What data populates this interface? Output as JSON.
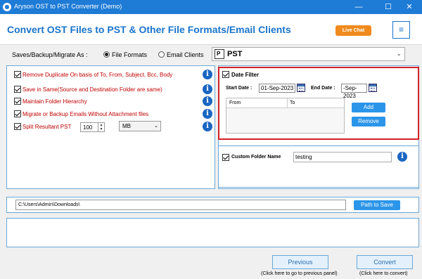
{
  "window": {
    "title": "Aryson OST to PST Converter (Demo)",
    "controls": {
      "minimize": "—",
      "maximize": "☐",
      "close": "✕"
    }
  },
  "header": {
    "heading": "Convert OST Files to PST & Other File Formats/Email Clients",
    "live_chat": "Live Chat",
    "menu_icon": "≡"
  },
  "saves": {
    "label": "Saves/Backup/Migrate As :",
    "options": [
      "File Formats",
      "Email Clients"
    ],
    "selected_option": "File Formats",
    "format_value": "PST",
    "format_icon": "pst-file-icon"
  },
  "options": [
    {
      "label": "Remove Duplicate On basis of To, From, Subject, Bcc, Body",
      "checked": true
    },
    {
      "label": "Save in Same(Source and Destination Folder are same)",
      "checked": true
    },
    {
      "label": "Maintain Folder Hierarchy",
      "checked": true
    },
    {
      "label": "Migrate or Backup Emails Without Attachment files",
      "checked": true
    },
    {
      "label": "Split Resultant PST",
      "checked": true
    }
  ],
  "split": {
    "size": "100",
    "unit": "MB"
  },
  "date_filter": {
    "label": "Date Filter",
    "checked": true,
    "start_label": "Start Date :",
    "start_value": "01-Sep-2023",
    "end_label": "End Date :",
    "end_value": "-Sep-2023",
    "columns": [
      "From",
      "To"
    ],
    "add_label": "Add",
    "remove_label": "Remove",
    "highlight_color": "#d32027"
  },
  "custom_folder": {
    "label": "Custom Folder Name",
    "checked": true,
    "value": "testing"
  },
  "path": {
    "value": "C:\\Users\\Admin\\Downloads\\",
    "button_label": "Path to Save"
  },
  "footer": {
    "previous_label": "Previous",
    "previous_hint": "(Click here to go to previous panel)",
    "convert_label": "Convert",
    "convert_hint": "(Click here to convert)"
  },
  "colors": {
    "titlebar": "#1e7bd6",
    "heading": "#1a74cc",
    "live_chat": "#f08a1c",
    "option_text": "#c00000",
    "button": "#2b95e9",
    "panel_border": "#6aa7d8"
  }
}
